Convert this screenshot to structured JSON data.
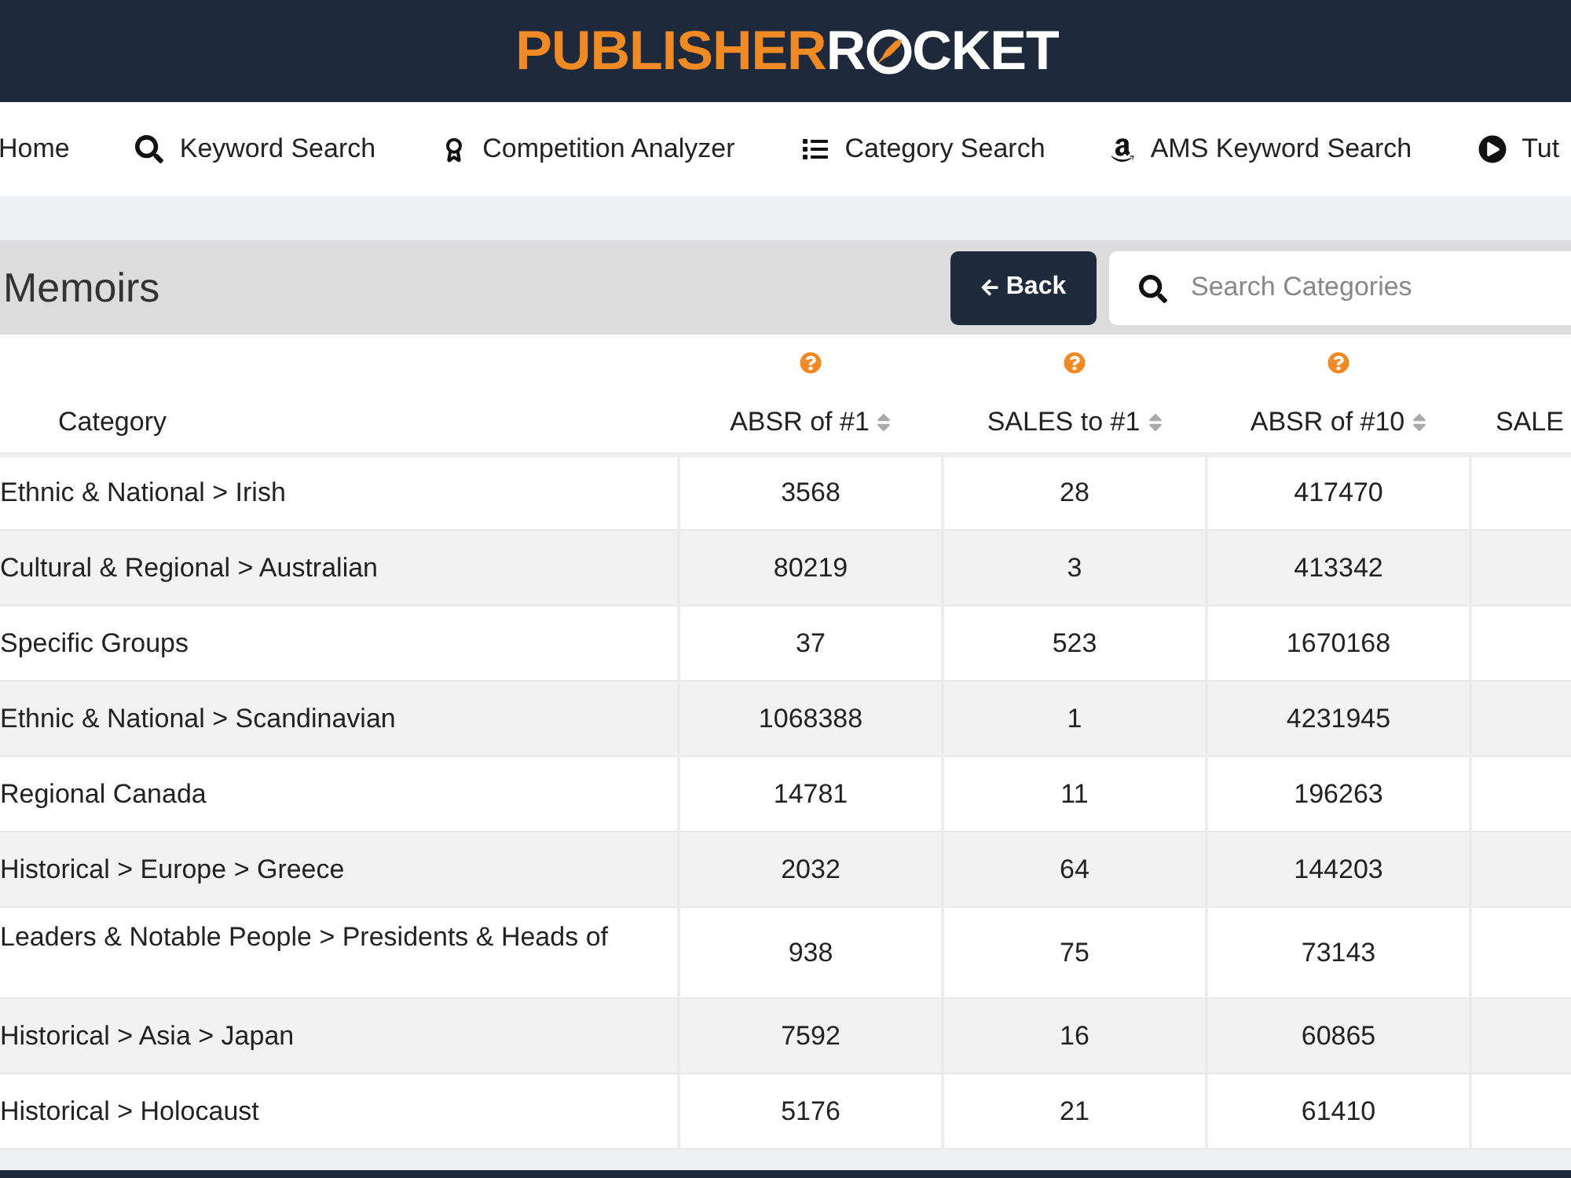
{
  "header": {
    "logo": {
      "part_1": "PUBLISHER",
      "part_2": "R",
      "part_3": "CKET"
    }
  },
  "nav": {
    "items": [
      {
        "label": "Home"
      },
      {
        "label": "Keyword Search"
      },
      {
        "label": "Competition Analyzer"
      },
      {
        "label": "Category Search"
      },
      {
        "label": "AMS Keyword Search"
      },
      {
        "label": "Tut"
      }
    ]
  },
  "page": {
    "title": "Memoirs",
    "back_button": {
      "label": "Back"
    },
    "search": {
      "placeholder": "Search Categories"
    }
  },
  "table": {
    "columns": [
      {
        "label": "Category",
        "help": false,
        "sortable": false
      },
      {
        "label": "ABSR of #1",
        "help": true,
        "sortable": true
      },
      {
        "label": "SALES to #1",
        "help": true,
        "sortable": true
      },
      {
        "label": "ABSR of #10",
        "help": true,
        "sortable": true
      },
      {
        "label": "SALE",
        "help": false,
        "sortable": false
      }
    ],
    "rows": [
      {
        "cells": [
          "Ethnic & National > Irish",
          "3568",
          "28",
          "417470"
        ]
      },
      {
        "cells": [
          "Cultural & Regional > Australian",
          "80219",
          "3",
          "413342"
        ]
      },
      {
        "cells": [
          "Specific Groups",
          "37",
          "523",
          "1670168"
        ]
      },
      {
        "cells": [
          "Ethnic & National > Scandinavian",
          "1068388",
          "1",
          "4231945"
        ]
      },
      {
        "cells": [
          "Regional Canada",
          "14781",
          "11",
          "196263"
        ]
      },
      {
        "cells": [
          "Historical > Europe > Greece",
          "2032",
          "64",
          "144203"
        ]
      },
      {
        "cells": [
          "Leaders & Notable People > Presidents & Heads of",
          "938",
          "75",
          "73143"
        ]
      },
      {
        "cells": [
          "Historical > Asia > Japan",
          "7592",
          "16",
          "60865"
        ]
      },
      {
        "cells": [
          "Historical > Holocaust",
          "5176",
          "21",
          "61410"
        ]
      }
    ]
  }
}
